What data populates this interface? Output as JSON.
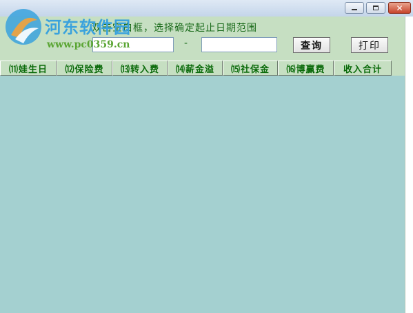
{
  "window": {
    "minimize_label": "",
    "maximize_label": "",
    "close_label": "✕"
  },
  "watermark": {
    "title": "河东软件园",
    "url": "www.pc0359.cn"
  },
  "filter": {
    "hint": "双击空白框，选择确定起止日期范围",
    "start_date": "",
    "end_date": "",
    "separator": "-",
    "query_label": "查询",
    "print_label": "打印"
  },
  "columns": [
    {
      "label": "⑾娃生日"
    },
    {
      "label": "⑿保险费"
    },
    {
      "label": "⒀转入费"
    },
    {
      "label": "⒁薪金溢"
    },
    {
      "label": "⒂社保金"
    },
    {
      "label": "⒃博赢费"
    },
    {
      "label": "收入合计"
    }
  ],
  "colors": {
    "panel_bg": "#c6dfc2",
    "grid_bg": "#a4d0d0",
    "accent_text": "#0a6a0a",
    "watermark_blue": "#3aa2dd",
    "watermark_green": "#5aa533"
  }
}
